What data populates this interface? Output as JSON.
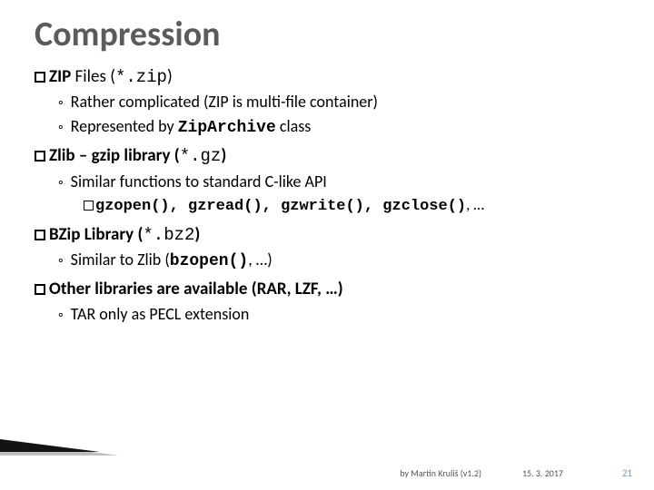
{
  "title": "Compression",
  "items": [
    {
      "head_bold": "ZIP",
      "head_rest": " Files (",
      "head_mono": "*.zip",
      "head_tail": ")",
      "subs": [
        {
          "text_a": "Rather complicated (ZIP is multi-file container)"
        },
        {
          "text_a": "Represented by ",
          "mono_b": "ZipArchive",
          "text_b": " class"
        }
      ]
    },
    {
      "head_bold": "Zlib",
      "head_rest_bold": " – gzip library (",
      "head_mono": "*.gz",
      "head_tail": ")",
      "subs": [
        {
          "text_a": "Similar functions to standard C-like API",
          "sub3": {
            "mono_b": "gzopen()",
            "text_a": ", ",
            "mono_b2": "gzread()",
            "text_b": ", ",
            "mono_b3": "gzwrite()",
            "text_c": ", ",
            "mono_b4": "gzclose()",
            "text_d": ", …"
          }
        }
      ]
    },
    {
      "head_bold": "BZip",
      "head_rest_bold": " Library (",
      "head_mono": "*.bz2",
      "head_tail": ")",
      "subs": [
        {
          "text_a": "Similar to Zlib (",
          "mono_b": "bzopen()",
          "text_b": ", …)"
        }
      ]
    },
    {
      "head_bold": "Other",
      "head_rest_bold": " libraries are available (RAR, LZF, …)",
      "subs": [
        {
          "text_a": "TAR only as PECL extension"
        }
      ]
    }
  ],
  "footer": {
    "author": "by Martin Kruliš (v1.2)",
    "date": "15. 3. 2017",
    "pagenum": "21"
  }
}
